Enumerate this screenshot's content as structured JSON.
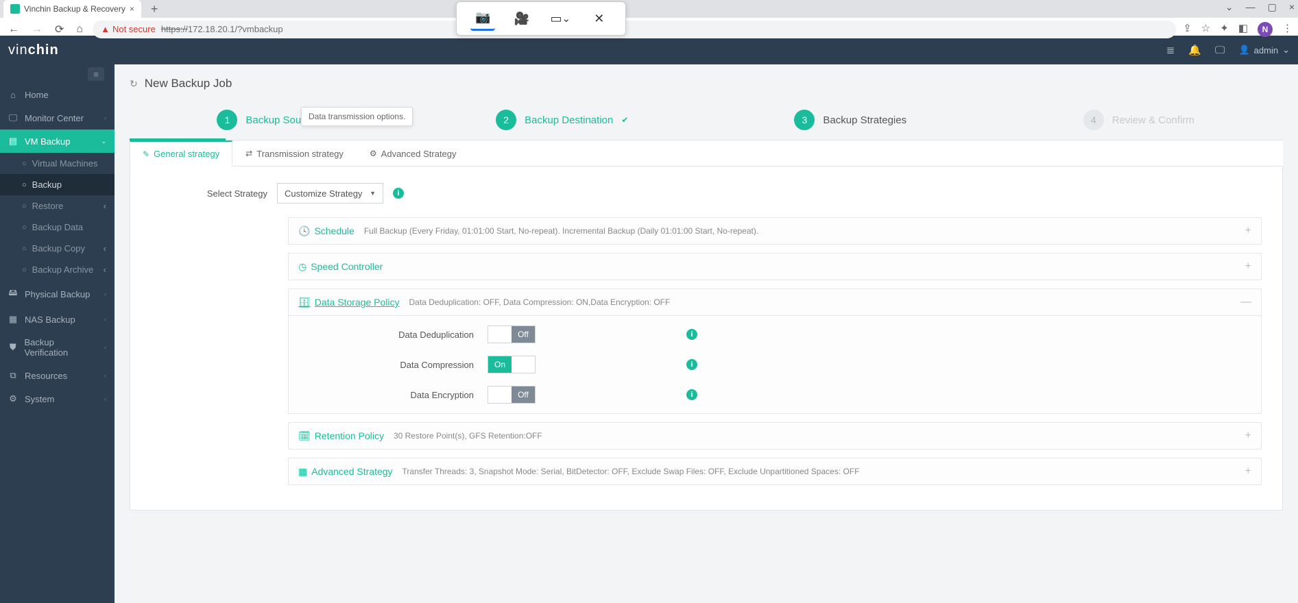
{
  "browser": {
    "tab_title": "Vinchin Backup & Recovery",
    "not_secure": "Not secure",
    "url_scheme": "https://",
    "url_host": "172.18.20.1",
    "url_path": "/?vmbackup",
    "avatar_letter": "N"
  },
  "header": {
    "logo_a": "vin",
    "logo_b": "chin",
    "user": "admin"
  },
  "sidebar": {
    "home": "Home",
    "monitor": "Monitor Center",
    "vm_backup": "VM Backup",
    "sub": {
      "vms": "Virtual Machines",
      "backup": "Backup",
      "restore": "Restore",
      "backup_data": "Backup Data",
      "backup_copy": "Backup Copy",
      "backup_archive": "Backup Archive"
    },
    "physical": "Physical Backup",
    "nas": "NAS Backup",
    "verification": "Backup Verification",
    "resources": "Resources",
    "system": "System"
  },
  "page": {
    "title": "New Backup Job"
  },
  "wizard": {
    "s1": {
      "num": "1",
      "label": "Backup Source"
    },
    "s2": {
      "num": "2",
      "label": "Backup Destination"
    },
    "s3": {
      "num": "3",
      "label": "Backup Strategies"
    },
    "s4": {
      "num": "4",
      "label": "Review & Confirm"
    }
  },
  "tooltip": "Data transmission options.",
  "tabs": {
    "general": "General strategy",
    "transmission": "Transmission strategy",
    "advanced": "Advanced Strategy"
  },
  "form": {
    "select_label": "Select Strategy",
    "select_value": "Customize Strategy"
  },
  "panels": {
    "schedule": {
      "title": "Schedule",
      "sub": "Full Backup (Every Friday, 01:01:00 Start, No-repeat). Incremental Backup (Daily 01:01:00 Start, No-repeat)."
    },
    "speed": {
      "title": "Speed Controller"
    },
    "storage": {
      "title": "Data Storage Policy",
      "sub": "Data Deduplication: OFF, Data Compression: ON,Data Encryption: OFF",
      "dedup": "Data Deduplication",
      "compress": "Data Compression",
      "encrypt": "Data Encryption",
      "on": "On",
      "off": "Off"
    },
    "retention": {
      "title": "Retention Policy",
      "sub": "30 Restore Point(s), GFS Retention:OFF"
    },
    "advanced": {
      "title": "Advanced Strategy",
      "sub": "Transfer Threads: 3, Snapshot Mode: Serial, BitDetector: OFF, Exclude Swap Files: OFF, Exclude Unpartitioned Spaces: OFF"
    }
  }
}
